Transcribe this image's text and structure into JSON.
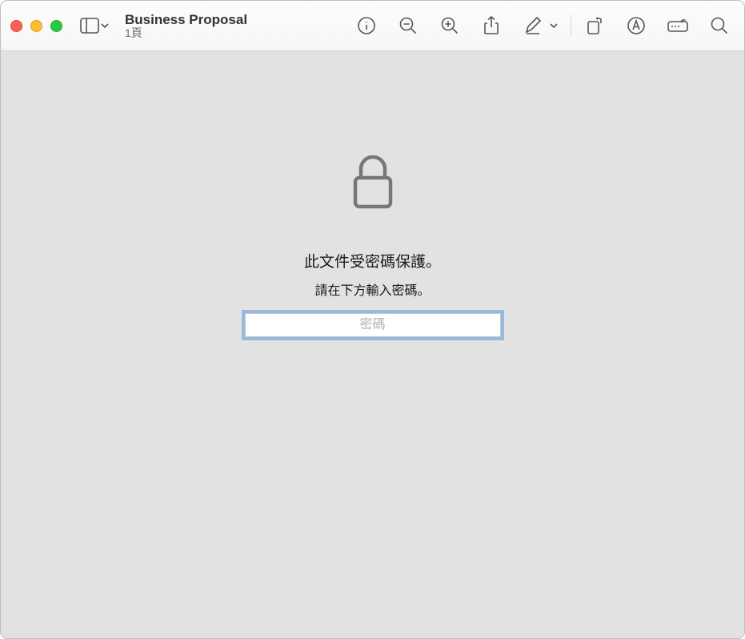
{
  "header": {
    "title": "Business Proposal",
    "pages": "1頁"
  },
  "toolbar": {
    "sidebar_icon": "sidebar-icon",
    "info_icon": "info-icon",
    "zoom_out_icon": "zoom-out-icon",
    "zoom_in_icon": "zoom-in-icon",
    "share_icon": "share-icon",
    "markup_icon": "markup-icon",
    "rotate_icon": "rotate-icon",
    "highlight_icon": "highlight-icon",
    "form_icon": "form-icon",
    "search_icon": "search-icon"
  },
  "content": {
    "heading": "此文件受密碼保護。",
    "subtext": "請在下方輸入密碼。",
    "password_placeholder": "密碼"
  }
}
